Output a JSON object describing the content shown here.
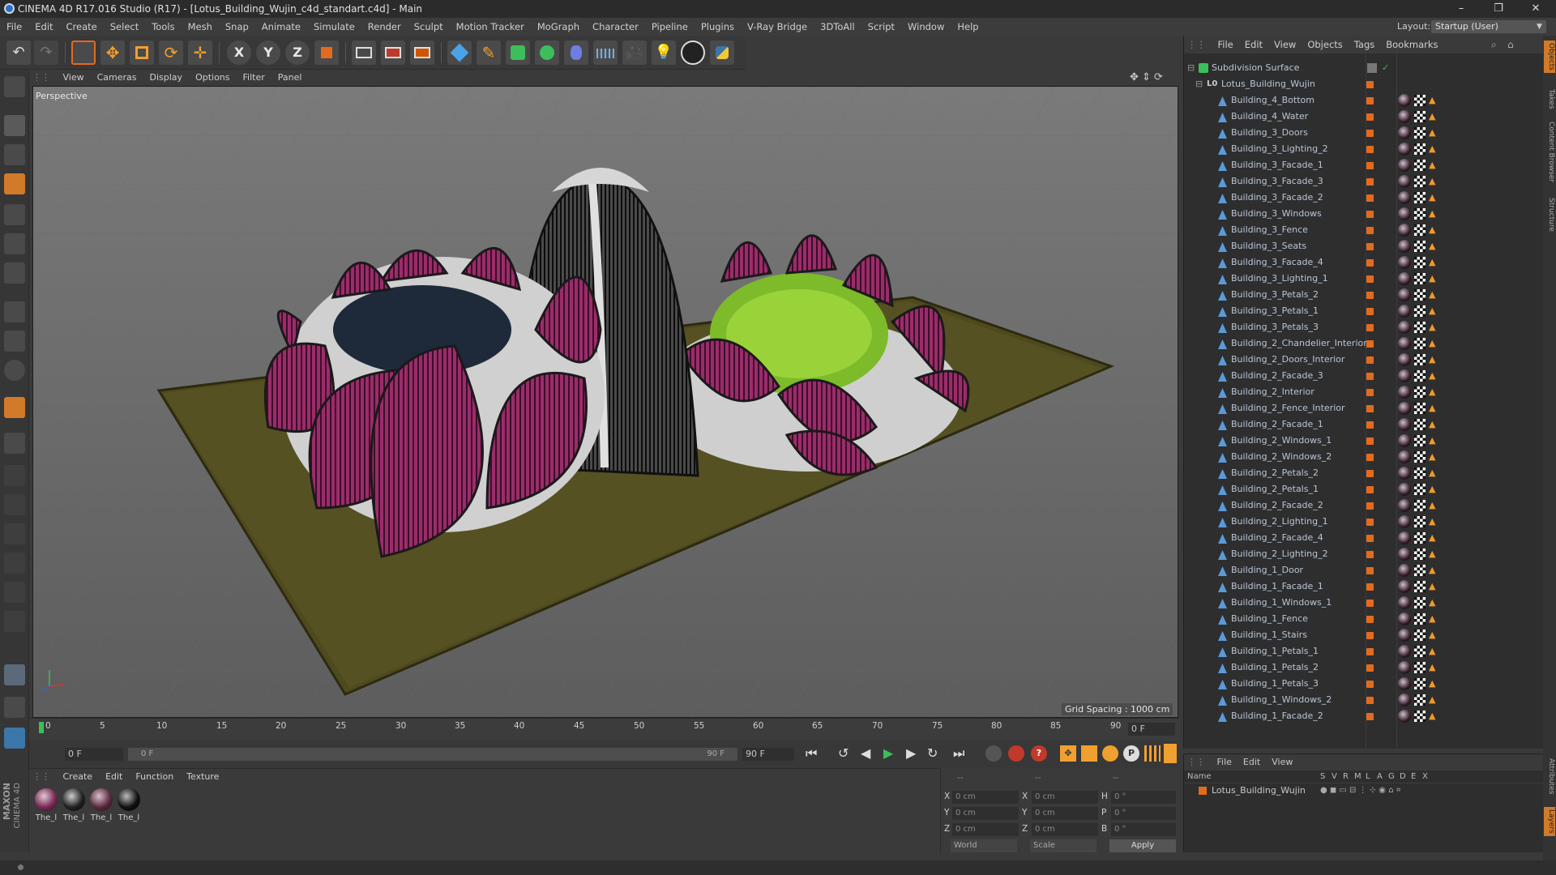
{
  "title": "CINEMA 4D R17.016 Studio (R17) - [Lotus_Building_Wujin_c4d_standart.c4d] - Main",
  "window_buttons": [
    "–",
    "❐",
    "✕"
  ],
  "menu": [
    "File",
    "Edit",
    "Create",
    "Select",
    "Tools",
    "Mesh",
    "Snap",
    "Animate",
    "Simulate",
    "Render",
    "Sculpt",
    "Motion Tracker",
    "MoGraph",
    "Character",
    "Pipeline",
    "Plugins",
    "V-Ray Bridge",
    "3DToAll",
    "Script",
    "Window",
    "Help"
  ],
  "layout": {
    "label": "Layout:",
    "value": "Startup (User)"
  },
  "viewport": {
    "menu": [
      "View",
      "Cameras",
      "Display",
      "Options",
      "Filter",
      "Panel"
    ],
    "label": "Perspective",
    "grid_spacing": "Grid Spacing : 1000 cm"
  },
  "timeline": {
    "ticks": [
      "0",
      "5",
      "10",
      "15",
      "20",
      "25",
      "30",
      "35",
      "40",
      "45",
      "50",
      "55",
      "60",
      "65",
      "70",
      "75",
      "80",
      "85",
      "90"
    ],
    "current_frame": "0 F",
    "start": "0 F",
    "slider_start": "0 F",
    "slider_end": "90 F",
    "end": "90 F"
  },
  "materials": {
    "menu": [
      "Create",
      "Edit",
      "Function",
      "Texture"
    ],
    "items": [
      "The_l",
      "The_l",
      "The_l",
      "The_l"
    ]
  },
  "coordinates": {
    "header": [
      "--",
      "--",
      "--"
    ],
    "rows": [
      {
        "a": "X",
        "av": "0 cm",
        "b": "X",
        "bv": "0 cm",
        "c": "H",
        "cv": "0 °"
      },
      {
        "a": "Y",
        "av": "0 cm",
        "b": "Y",
        "bv": "0 cm",
        "c": "P",
        "cv": "0 °"
      },
      {
        "a": "Z",
        "av": "0 cm",
        "b": "Z",
        "bv": "0 cm",
        "c": "B",
        "cv": "0 °"
      }
    ],
    "mode": "World",
    "type": "Scale",
    "apply": "Apply"
  },
  "objects": {
    "menu": [
      "File",
      "Edit",
      "View",
      "Objects",
      "Tags",
      "Bookmarks"
    ],
    "root": "Subdivision Surface",
    "group": "Lotus_Building_Wujin",
    "children": [
      "Building_4_Bottom",
      "Building_4_Water",
      "Building_3_Doors",
      "Building_3_Lighting_2",
      "Building_3_Facade_1",
      "Building_3_Facade_3",
      "Building_3_Facade_2",
      "Building_3_Windows",
      "Building_3_Fence",
      "Building_3_Seats",
      "Building_3_Facade_4",
      "Building_3_Lighting_1",
      "Building_3_Petals_2",
      "Building_3_Petals_1",
      "Building_3_Petals_3",
      "Building_2_Chandelier_Interior",
      "Building_2_Doors_Interior",
      "Building_2_Facade_3",
      "Building_2_Interior",
      "Building_2_Fence_Interior",
      "Building_2_Facade_1",
      "Building_2_Windows_1",
      "Building_2_Windows_2",
      "Building_2_Petals_2",
      "Building_2_Petals_1",
      "Building_2_Facade_2",
      "Building_2_Lighting_1",
      "Building_2_Facade_4",
      "Building_2_Lighting_2",
      "Building_1_Door",
      "Building_1_Facade_1",
      "Building_1_Windows_1",
      "Building_1_Fence",
      "Building_1_Stairs",
      "Building_1_Petals_1",
      "Building_1_Petals_2",
      "Building_1_Petals_3",
      "Building_1_Windows_2",
      "Building_1_Facade_2"
    ]
  },
  "layers": {
    "menu": [
      "File",
      "Edit",
      "View"
    ],
    "columns": [
      "Name",
      "S",
      "V",
      "R",
      "M",
      "L",
      "A",
      "G",
      "D",
      "E",
      "X"
    ],
    "row": "Lotus_Building_Wujin"
  },
  "side_tabs": [
    "Objects",
    "Takes",
    "Content Browser",
    "Structure",
    "Attributes",
    "Layers"
  ],
  "brand": [
    "MAXON",
    "CINEMA 4D"
  ],
  "colors": {
    "accent": "#e36b1e",
    "selection": "#f0a030",
    "petal": "#9b2c6a",
    "ground": "#4e4a1e"
  }
}
